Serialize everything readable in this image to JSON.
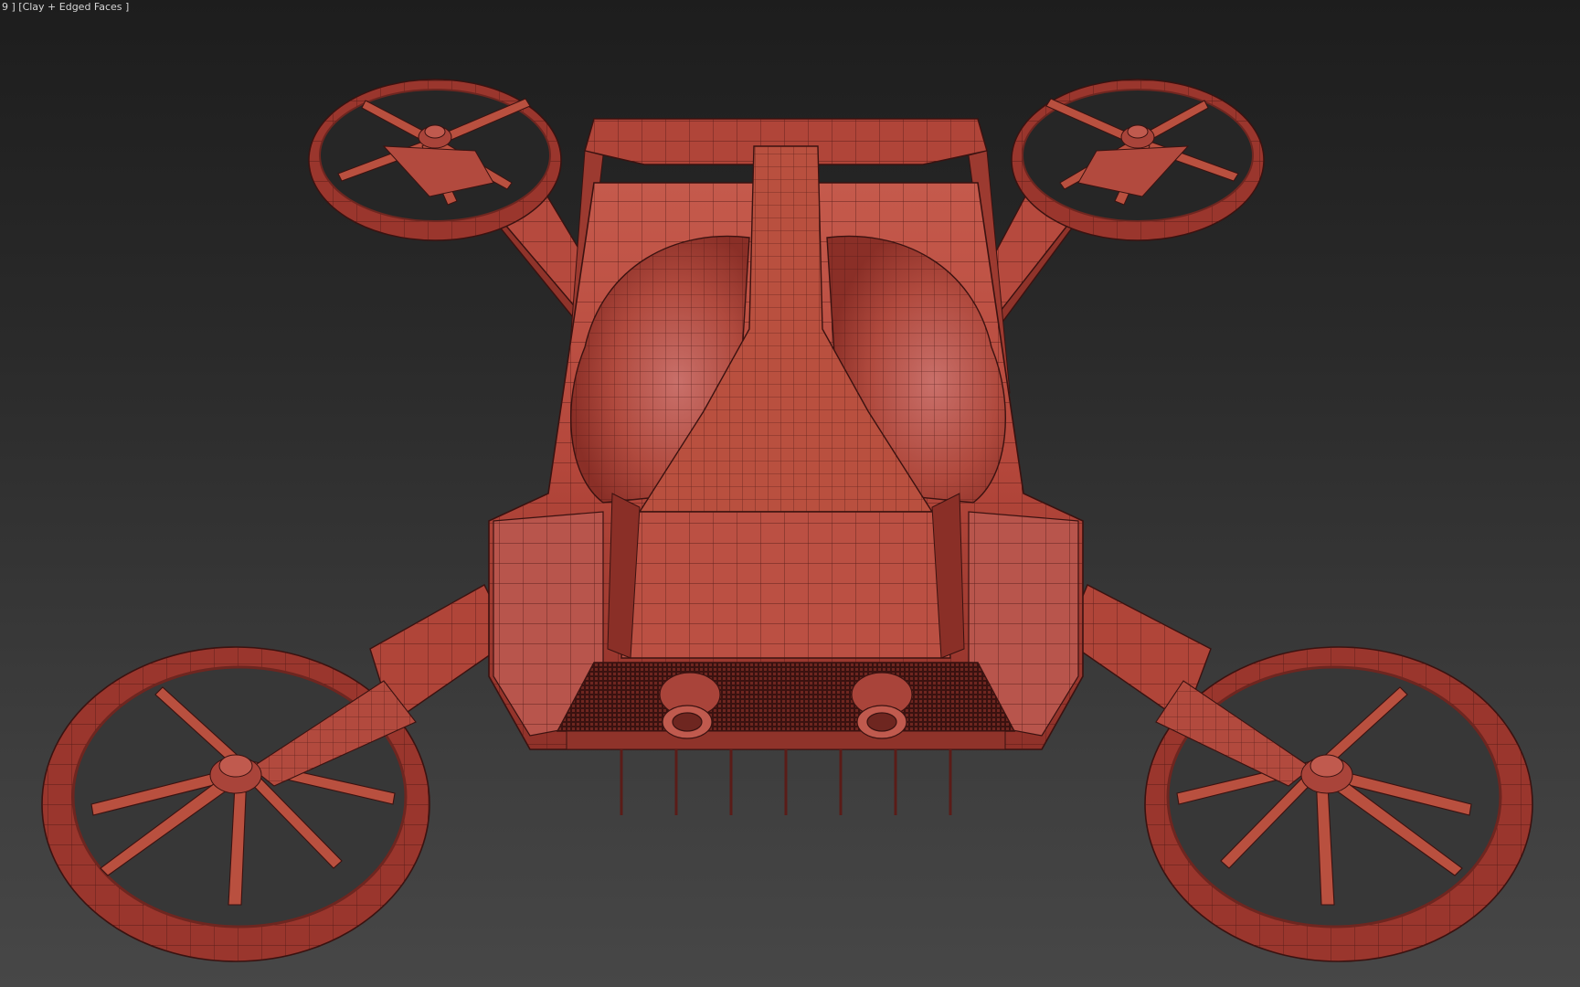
{
  "viewport": {
    "label": "9 ] [Clay + Edged Faces ]",
    "shading_mode": "Clay + Edged Faces",
    "colors": {
      "background_top": "#1d1d1d",
      "background_bottom": "#474747",
      "clay": "#b84a3e",
      "clay_light": "#c8665a",
      "clay_dark": "#6e2620",
      "edge": "#3a1210"
    }
  },
  "scene": {
    "object": "quadcopter-flying-car",
    "rotors": 4,
    "blades_per_rotor": 6,
    "exhaust_nozzles": 2,
    "bottom_antennas": 7
  }
}
